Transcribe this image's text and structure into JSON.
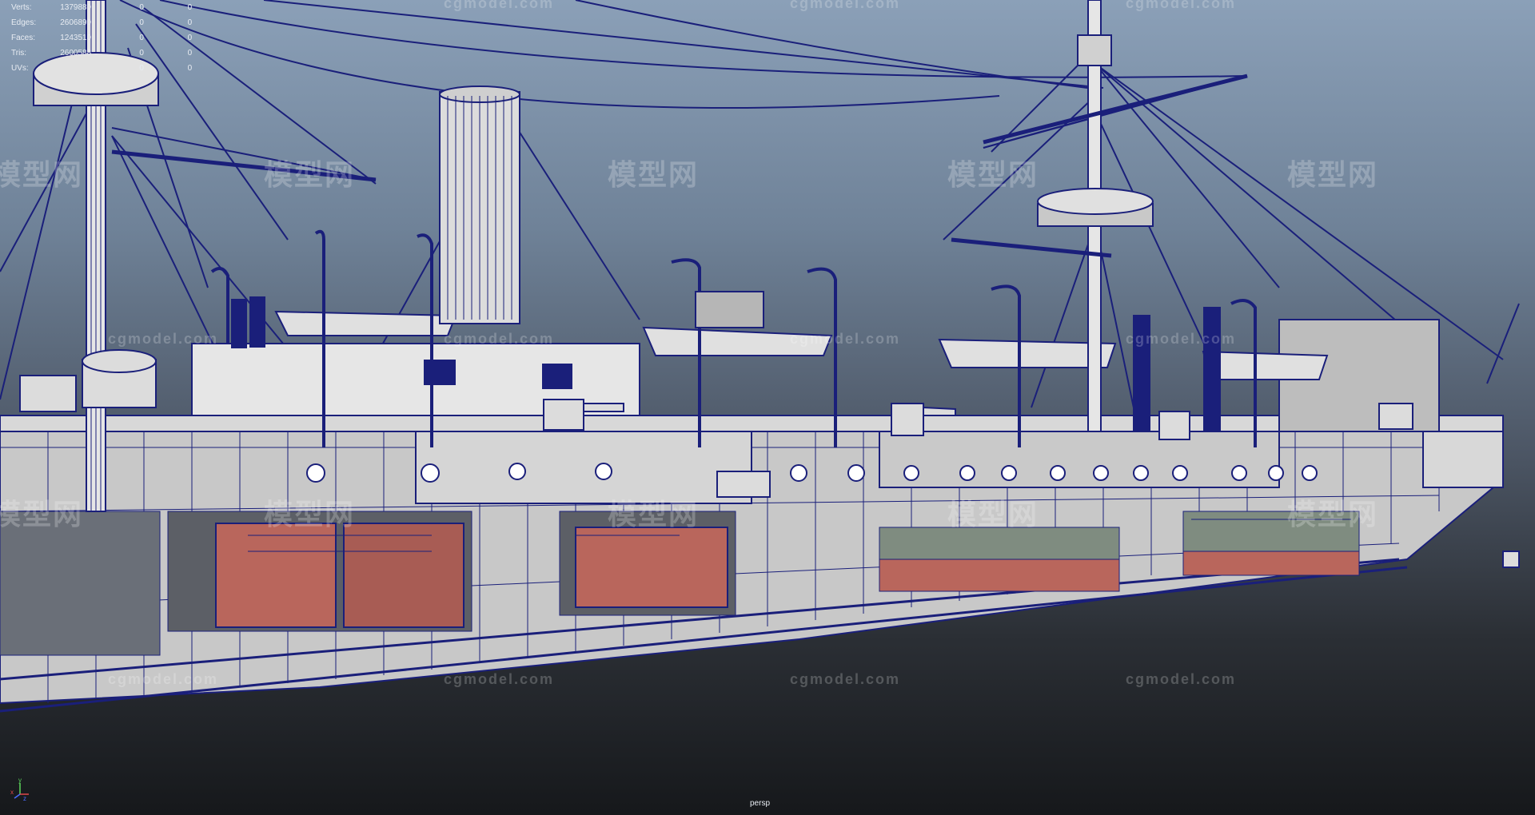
{
  "hud": {
    "rows": [
      {
        "label": "Verts:",
        "value": "1379880",
        "sel": "0",
        "comp": "0"
      },
      {
        "label": "Edges:",
        "value": "2606890",
        "sel": "0",
        "comp": "0"
      },
      {
        "label": "Faces:",
        "value": "1243510",
        "sel": "0",
        "comp": "0"
      },
      {
        "label": "Tris:",
        "value": "2600588",
        "sel": "0",
        "comp": "0"
      },
      {
        "label": "UVs:",
        "value": "",
        "sel": "0",
        "comp": "0"
      }
    ]
  },
  "camera": {
    "label": "persp"
  },
  "axis": {
    "y": "y",
    "x": "x",
    "z": "z"
  },
  "watermarks": {
    "cn": "模型网",
    "en": "cgmodel.com"
  },
  "colors": {
    "wire": "#1a1f7a",
    "hull": "#d2d2d2",
    "boiler": "#b9665c",
    "bg_top": "#8ba0b8",
    "bg_bottom": "#16181b"
  }
}
